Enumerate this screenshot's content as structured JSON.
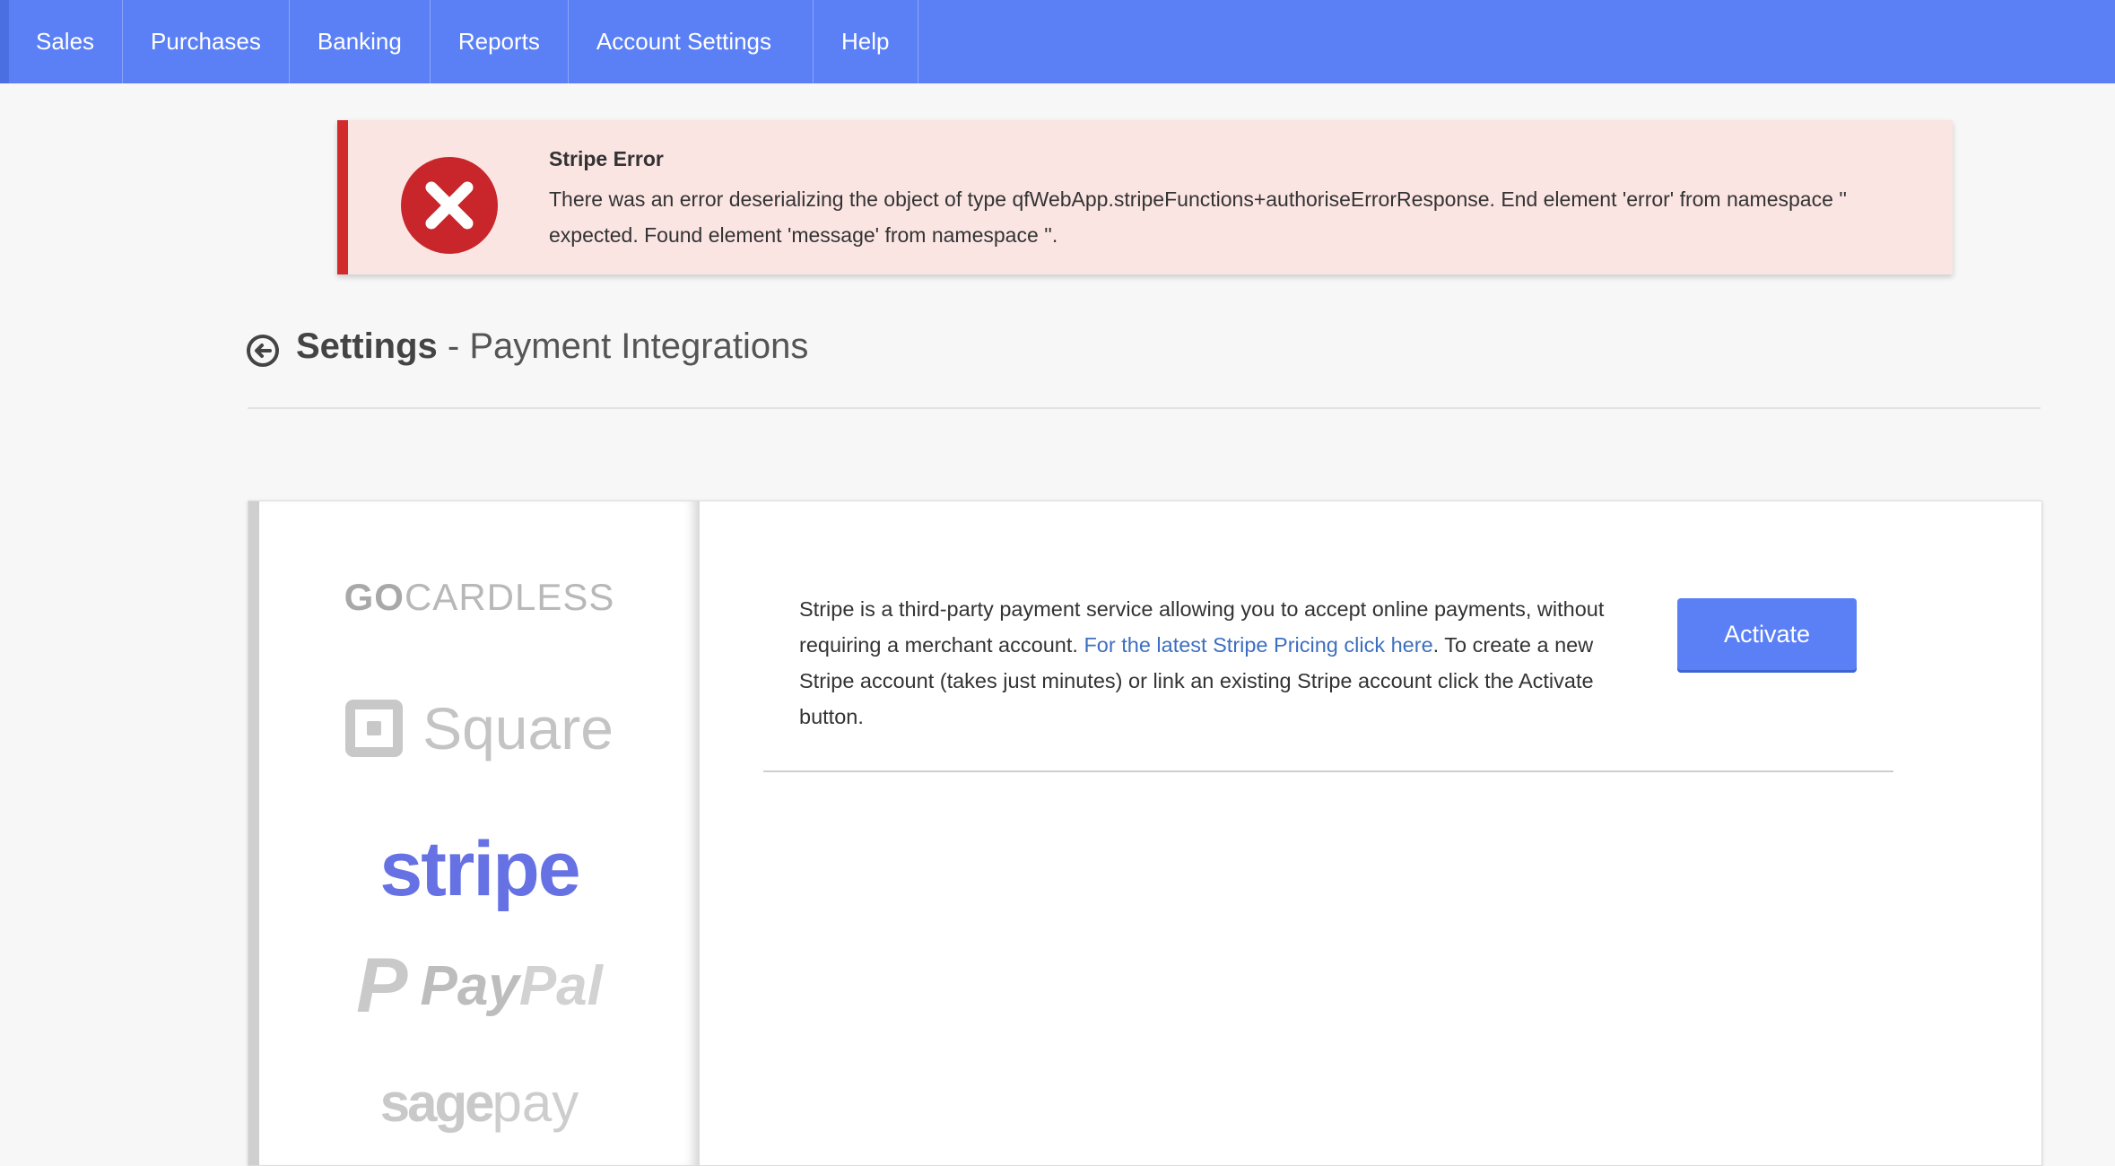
{
  "nav": {
    "items": [
      {
        "label": "Sales"
      },
      {
        "label": "Purchases"
      },
      {
        "label": "Banking"
      },
      {
        "label": "Reports"
      },
      {
        "label": "Account Settings"
      },
      {
        "label": "Help"
      }
    ]
  },
  "alert": {
    "title": "Stripe Error",
    "message": "There was an error deserializing the object of type qfWebApp.stripeFunctions+authoriseErrorResponse. End element 'error' from namespace '' expected. Found element 'message' from namespace ''.",
    "icon": "close-circle-icon",
    "color": "#d12c2b"
  },
  "page": {
    "title_strong": "Settings",
    "title_rest": " - Payment Integrations"
  },
  "providers": {
    "gocardless_bold": "GO",
    "gocardless_rest": "CARDLESS",
    "square": "Square",
    "stripe": "stripe",
    "paypal_pay": "Pay",
    "paypal_pal": "Pal",
    "sage": "sage",
    "pay": "pay"
  },
  "content": {
    "text_before": "Stripe is a third-party payment service allowing you to accept online payments, without requiring a merchant account. ",
    "link": "For the latest Stripe Pricing click here",
    "text_after": ". To create a new Stripe account (takes just minutes) or link an existing Stripe account click the Activate button.",
    "activate_label": "Activate"
  },
  "colors": {
    "nav": "#5b80f6",
    "accent": "#5b80f6",
    "stripe": "#6672e4",
    "error": "#d12c2b"
  }
}
